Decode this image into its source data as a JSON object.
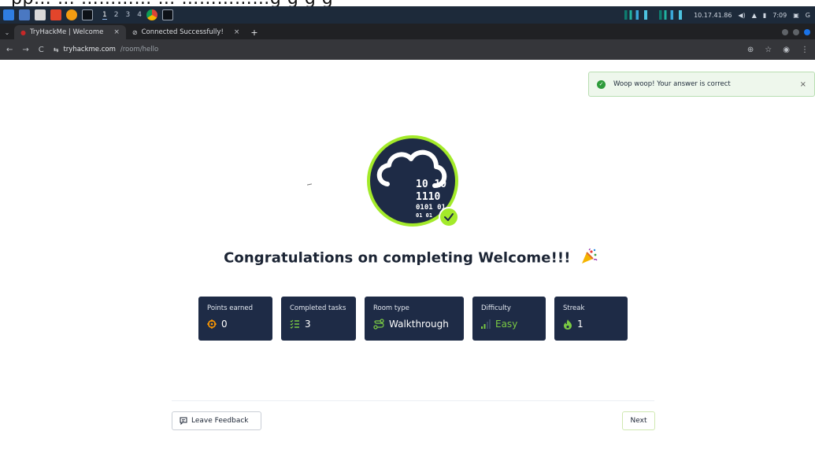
{
  "caption": {
    "text": "pp… … ………… … ……………g g g g"
  },
  "taskbar": {
    "workspaces": [
      "1",
      "2",
      "3",
      "4"
    ],
    "active_workspace": "1",
    "ip": "10.17.41.86",
    "time": "7:09",
    "status_letter": "G"
  },
  "browser": {
    "tabs": [
      {
        "label": "TryHackMe | Welcome",
        "active": true
      },
      {
        "label": "Connected Successfully!",
        "active": false
      }
    ],
    "close_glyph": "×",
    "new_tab_glyph": "+",
    "url_host": "tryhackme.com",
    "url_path": "/room/hello"
  },
  "toast": {
    "message": "Woop woop! Your answer is correct",
    "close": "×"
  },
  "badge": {
    "lines": [
      "10 10",
      "1110",
      "0101 01",
      "01 01"
    ]
  },
  "title": {
    "text": "Congratulations on completing Welcome!!!"
  },
  "stats": [
    {
      "label": "Points earned",
      "value": "0",
      "icon": "target-icon"
    },
    {
      "label": "Completed tasks",
      "value": "3",
      "icon": "checklist-icon"
    },
    {
      "label": "Room type",
      "value": "Walkthrough",
      "icon": "route-icon"
    },
    {
      "label": "Difficulty",
      "value": "Easy",
      "icon": "signal-icon"
    },
    {
      "label": "Streak",
      "value": "1",
      "icon": "flame-icon"
    }
  ],
  "actions": {
    "feedback": "Leave Feedback",
    "next": "Next"
  },
  "colors": {
    "navy": "#1e2b46",
    "lime": "#a3ea2a",
    "orange": "#ff9800",
    "green": "#7ac943",
    "toast_bg": "#eef7ec"
  }
}
